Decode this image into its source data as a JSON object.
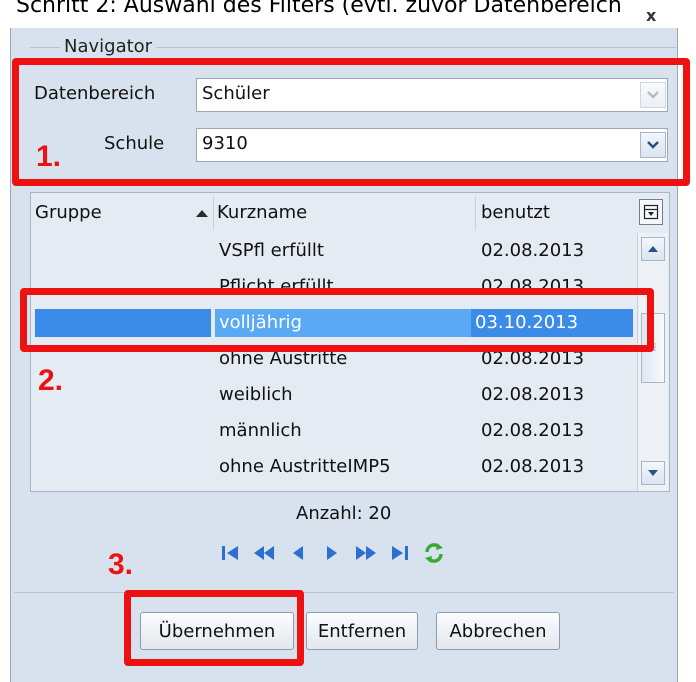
{
  "heading": "Schritt 2: Auswahl des Filters (evtl. zuvor Datenbereich",
  "close_glyph": "x",
  "navigator": {
    "title": "Navigator",
    "datenbereich_label": "Datenbereich",
    "datenbereich_value": "Schüler",
    "schule_label": "Schule",
    "schule_value": "9310"
  },
  "list": {
    "columns": [
      "Gruppe",
      "Kurzname",
      "benutzt"
    ],
    "sort_column": "Kurzname",
    "sort_direction": "ascending",
    "rows": [
      {
        "gruppe": "",
        "kurzname": "VSPfl erfüllt",
        "benutzt": "02.08.2013",
        "selected": false
      },
      {
        "gruppe": "",
        "kurzname": "Pflicht erfüllt",
        "benutzt": "02.08.2013",
        "selected": false
      },
      {
        "gruppe": "",
        "kurzname": "volljährig",
        "benutzt": "03.10.2013",
        "selected": true
      },
      {
        "gruppe": "",
        "kurzname": "ohne Austritte",
        "benutzt": "02.08.2013",
        "selected": false
      },
      {
        "gruppe": "",
        "kurzname": "weiblich",
        "benutzt": "02.08.2013",
        "selected": false
      },
      {
        "gruppe": "",
        "kurzname": "männlich",
        "benutzt": "02.08.2013",
        "selected": false
      },
      {
        "gruppe": "",
        "kurzname": "ohne AustritteIMP5",
        "benutzt": "02.08.2013",
        "selected": false
      }
    ]
  },
  "count_text": "Anzahl: 20",
  "nav_icons": [
    "first-record-icon",
    "previous-page-icon",
    "previous-record-icon",
    "next-record-icon",
    "next-page-icon",
    "last-record-icon",
    "refresh-icon"
  ],
  "buttons": {
    "apply": "Übernehmen",
    "remove": "Entfernen",
    "cancel": "Abbrechen"
  },
  "annotations": {
    "step1": "1.",
    "step2": "2.",
    "step3": "3."
  },
  "colors": {
    "panel_bg": "#d8e2ee",
    "selection": "#3b8be8",
    "selection_cell": "#5aa9f5",
    "annotation_red": "#ee1111",
    "nav_blue": "#2c6fd1",
    "refresh_green": "#3aa832"
  }
}
